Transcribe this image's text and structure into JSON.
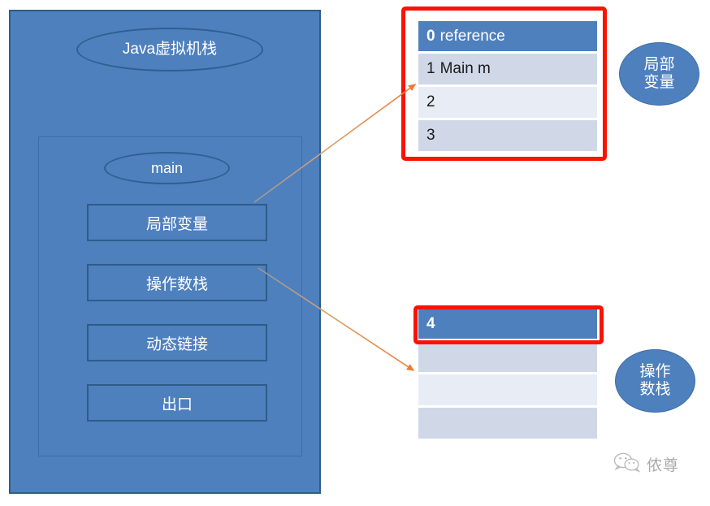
{
  "diagram": {
    "title_ellipse": "Java虚拟机栈",
    "frame": {
      "name_ellipse": "main",
      "slots": [
        "局部变量",
        "操作数栈",
        "动态链接",
        "出口"
      ]
    }
  },
  "local_variable_table": {
    "rows": [
      {
        "index": "0",
        "value": "reference",
        "header": true
      },
      {
        "index": "1",
        "value": "Main m",
        "header": false
      },
      {
        "index": "2",
        "value": "",
        "header": false
      },
      {
        "index": "3",
        "value": "",
        "header": false
      }
    ]
  },
  "operand_stack_table": {
    "rows": [
      {
        "index": "4",
        "value": "",
        "header": true
      },
      {
        "index": "",
        "value": "",
        "header": false
      },
      {
        "index": "",
        "value": "",
        "header": false
      },
      {
        "index": "",
        "value": "",
        "header": false
      }
    ]
  },
  "callouts": {
    "local": "局部\n变量",
    "operand": "操作\n数栈"
  },
  "watermark": {
    "text": "侬尊",
    "icon": "wechat-icon"
  },
  "colors": {
    "panel_blue": "#4e80be",
    "border_navy": "#2e5c8a",
    "highlight_red": "#fb1200",
    "arrow_orange": "#ed7d31",
    "row_shade_dark": "#d0d8e8",
    "row_shade_light": "#e8edf5"
  }
}
